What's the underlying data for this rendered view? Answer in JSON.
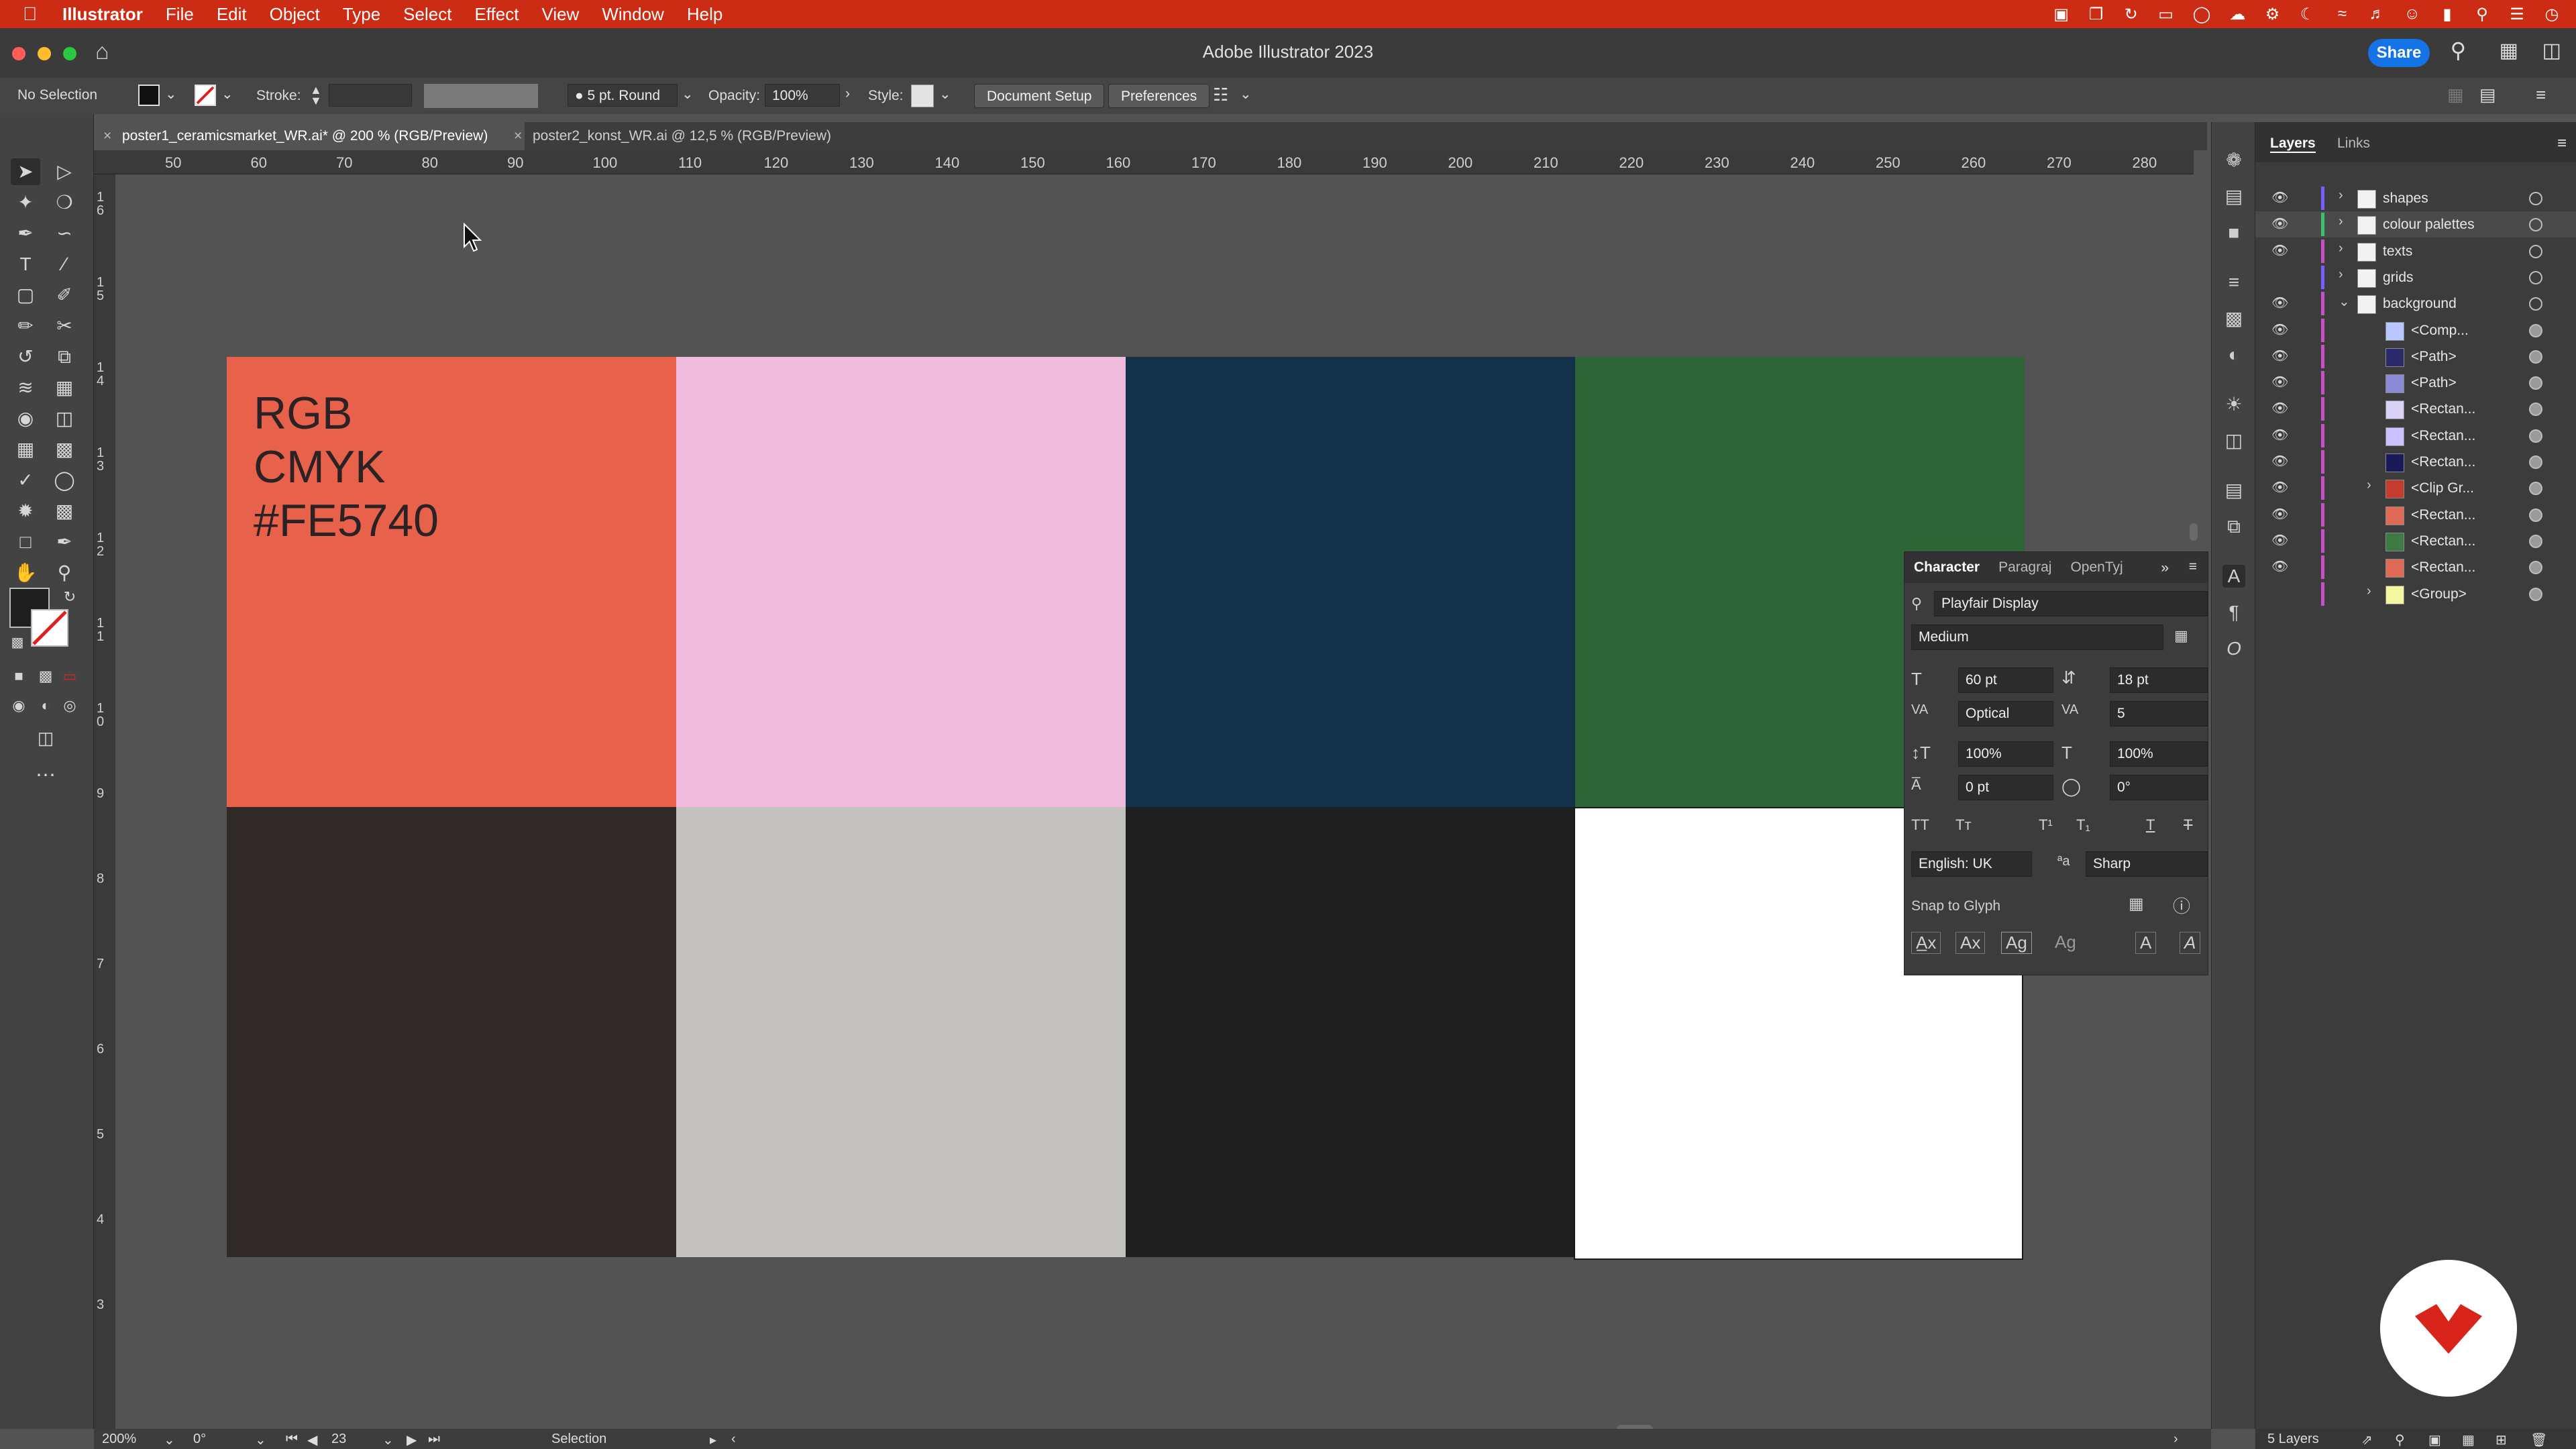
{
  "menubar": {
    "apple_icon": "apple-icon",
    "app_name": "Illustrator",
    "items": [
      "File",
      "Edit",
      "Object",
      "Type",
      "Select",
      "Effect",
      "View",
      "Window",
      "Help"
    ]
  },
  "window": {
    "title": "Adobe Illustrator 2023",
    "share_label": "Share"
  },
  "controlbar": {
    "selection_text": "No Selection",
    "stroke_label": "Stroke:",
    "brush_value": "5 pt. Round",
    "opacity_label": "Opacity:",
    "opacity_value": "100%",
    "style_label": "Style:",
    "document_setup": "Document Setup",
    "preferences": "Preferences"
  },
  "tabs": [
    {
      "label": "poster1_ceramicsmarket_WR.ai* @ 200 % (RGB/Preview)",
      "active": true
    },
    {
      "label": "poster2_konst_WR.ai @ 12,5 % (RGB/Preview)",
      "active": false
    }
  ],
  "ruler": {
    "h_ticks": [
      "50",
      "60",
      "70",
      "80",
      "90",
      "100",
      "110",
      "120",
      "130",
      "140",
      "150",
      "160",
      "170",
      "180",
      "190",
      "200",
      "210",
      "220",
      "230",
      "240",
      "250",
      "260",
      "270",
      "280"
    ],
    "v_ticks": [
      "1 6",
      "1 5",
      "1 4",
      "1 3",
      "1 2",
      "1 1",
      "1 0",
      "9",
      "8",
      "7",
      "6",
      "5",
      "4",
      "3"
    ]
  },
  "artboard": {
    "swatch_text": [
      "RGB",
      "CMYK",
      "#FE5740"
    ],
    "swatches": [
      {
        "name": "coral",
        "color": "#e8614a"
      },
      {
        "name": "pink",
        "color": "#efbbdc"
      },
      {
        "name": "navy",
        "color": "#14314a"
      },
      {
        "name": "green",
        "color": "#2e6437"
      },
      {
        "name": "dark-brown",
        "color": "#2f2a28"
      },
      {
        "name": "light-grey",
        "color": "#c3c2be"
      },
      {
        "name": "charcoal",
        "color": "#1f1f1f"
      },
      {
        "name": "white",
        "color": "#ffffff"
      }
    ]
  },
  "character_panel": {
    "tabs": [
      "Character",
      "Paragraj",
      "OpenTyj"
    ],
    "font_family": "Playfair Display",
    "font_style": "Medium",
    "font_size": "60 pt",
    "leading": "18 pt",
    "kerning": "Optical",
    "tracking": "5",
    "vertical_scale": "100%",
    "horizontal_scale": "100%",
    "baseline_shift": "0 pt",
    "rotation": "0°",
    "language": "English: UK",
    "antialias": "Sharp",
    "snap_to_glyph": "Snap to Glyph"
  },
  "layers_panel": {
    "tabs": [
      "Layers",
      "Links"
    ],
    "rows": [
      {
        "name": "shapes",
        "bar": "#7a5cff",
        "expandable": true,
        "expanded": false,
        "eye": true,
        "indent": 0
      },
      {
        "name": "colour palettes",
        "bar": "#3cc26a",
        "expandable": true,
        "expanded": false,
        "eye": true,
        "indent": 0,
        "selected": true
      },
      {
        "name": "texts",
        "bar": "#c94fc9",
        "expandable": true,
        "expanded": false,
        "eye": true,
        "indent": 0
      },
      {
        "name": "grids",
        "bar": "#7a5cff",
        "expandable": true,
        "expanded": false,
        "eye": false,
        "indent": 0
      },
      {
        "name": "background",
        "bar": "#c94fc9",
        "expandable": true,
        "expanded": true,
        "eye": true,
        "indent": 0
      },
      {
        "name": "<Comp...",
        "bar": "#c94fc9",
        "eye": true,
        "indent": 1,
        "thumb": "#b9c6ff"
      },
      {
        "name": "<Path>",
        "bar": "#c94fc9",
        "eye": true,
        "indent": 1,
        "thumb": "#2a2a6a"
      },
      {
        "name": "<Path>",
        "bar": "#c94fc9",
        "eye": true,
        "indent": 1,
        "thumb": "#8a8ad6"
      },
      {
        "name": "<Rectan...",
        "bar": "#c94fc9",
        "eye": true,
        "indent": 1,
        "thumb": "#d9d2f5"
      },
      {
        "name": "<Rectan...",
        "bar": "#c94fc9",
        "eye": true,
        "indent": 1,
        "thumb": "#c9c2ff"
      },
      {
        "name": "<Rectan...",
        "bar": "#c94fc9",
        "eye": true,
        "indent": 1,
        "thumb": "#1a1a5a"
      },
      {
        "name": "<Clip Gr...",
        "bar": "#c94fc9",
        "eye": true,
        "indent": 1,
        "thumb": "#c73a2e",
        "expandable": true
      },
      {
        "name": "<Rectan...",
        "bar": "#c94fc9",
        "eye": true,
        "indent": 1,
        "thumb": "#e06a55"
      },
      {
        "name": "<Rectan...",
        "bar": "#c94fc9",
        "eye": true,
        "indent": 1,
        "thumb": "#3d7a45"
      },
      {
        "name": "<Rectan...",
        "bar": "#c94fc9",
        "eye": true,
        "indent": 1,
        "thumb": "#e06a55"
      },
      {
        "name": "<Group>",
        "bar": "#c94fc9",
        "eye": false,
        "indent": 1,
        "thumb": "#f3f7a0",
        "expandable": true
      }
    ],
    "footer_count": "5 Layers"
  },
  "statusbar": {
    "zoom": "200%",
    "rotation": "0°",
    "artboard_number": "23",
    "tool_name": "Selection"
  },
  "colors": {
    "accent": "#cc2b14",
    "share_blue": "#1473e6",
    "badge_red": "#d9241b"
  }
}
